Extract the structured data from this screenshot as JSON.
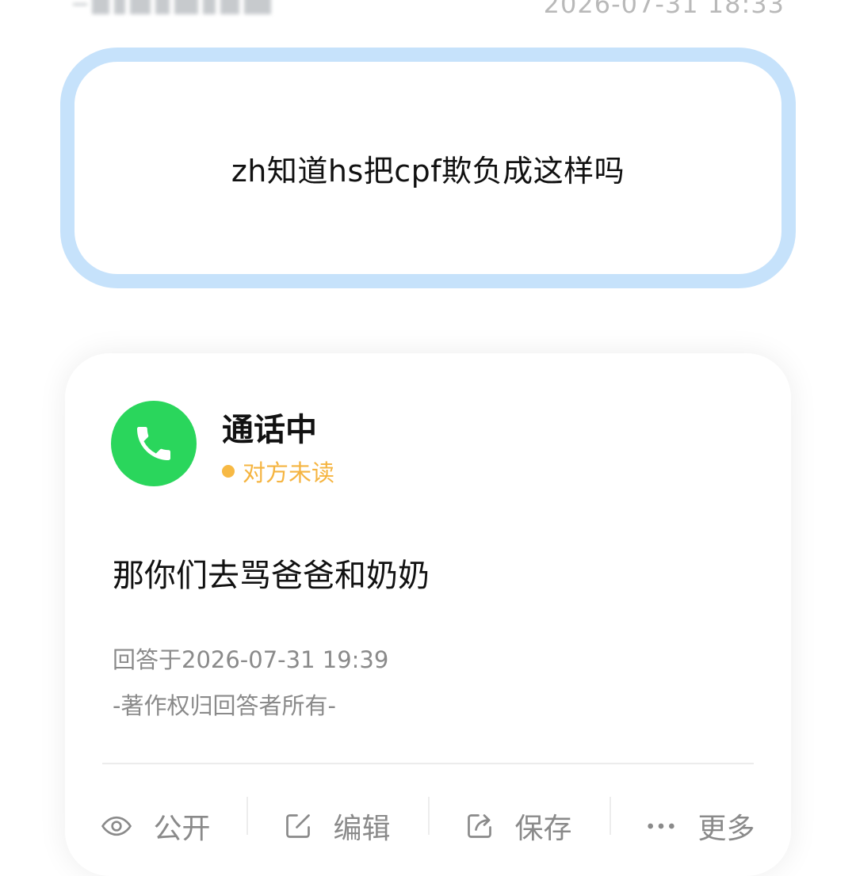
{
  "header": {
    "timestamp": "2026-07-31 18:33"
  },
  "question": {
    "text": "zh知道hs把cpf欺负成这样吗"
  },
  "answer": {
    "status_icon": "phone-icon",
    "status_title": "通话中",
    "read_status": "对方未读",
    "text": "那你们去骂爸爸和奶奶",
    "answered_at": "回答于2026-07-31 19:39",
    "copyright": "-著作权归回答者所有-"
  },
  "actions": {
    "public": {
      "icon": "eye-icon",
      "label": "公开"
    },
    "edit": {
      "icon": "edit-icon",
      "label": "编辑"
    },
    "save": {
      "icon": "share-icon",
      "label": "保存"
    },
    "more": {
      "icon": "more-icon",
      "label": "更多"
    }
  },
  "colors": {
    "question_border": "#c6e2fb",
    "call_green": "#2ad65c",
    "unread_orange": "#f5b440",
    "muted_text": "#8a8a8a"
  }
}
